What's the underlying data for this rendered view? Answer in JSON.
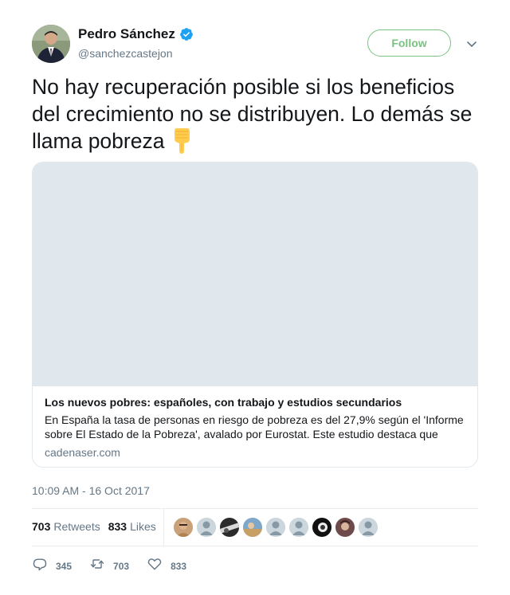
{
  "author": {
    "name": "Pedro Sánchez",
    "handle": "@sanchezcastejon",
    "verified": true
  },
  "follow_label": "Follow",
  "tweet": {
    "text": "No hay recuperación posible si los beneficios del crecimiento no se distribuyen. Lo demás se llama pobreza",
    "emoji": "backhand-index-pointing-down"
  },
  "card": {
    "title": "Los nuevos pobres: españoles, con trabajo y estudios secundarios",
    "description": "En España la tasa de personas en riesgo de pobreza es del 27,9% según el 'Informe sobre El Estado de la Pobreza', avalado por Eurostat. Este estudio destaca que",
    "domain": "cadenaser.com"
  },
  "timestamp": "10:09 AM - 16 Oct 2017",
  "stats": {
    "retweets_count": "703",
    "retweets_label": "Retweets",
    "likes_count": "833",
    "likes_label": "Likes"
  },
  "actions": {
    "reply_count": "345",
    "retweet_count": "703",
    "like_count": "833"
  },
  "colors": {
    "follow_green": "#79c280",
    "verified_blue": "#1da1f2",
    "muted_text": "#657786",
    "border": "#e1e8ed"
  },
  "icons": [
    "verified-badge-icon",
    "chevron-down-icon",
    "reply-icon",
    "retweet-icon",
    "heart-icon"
  ]
}
